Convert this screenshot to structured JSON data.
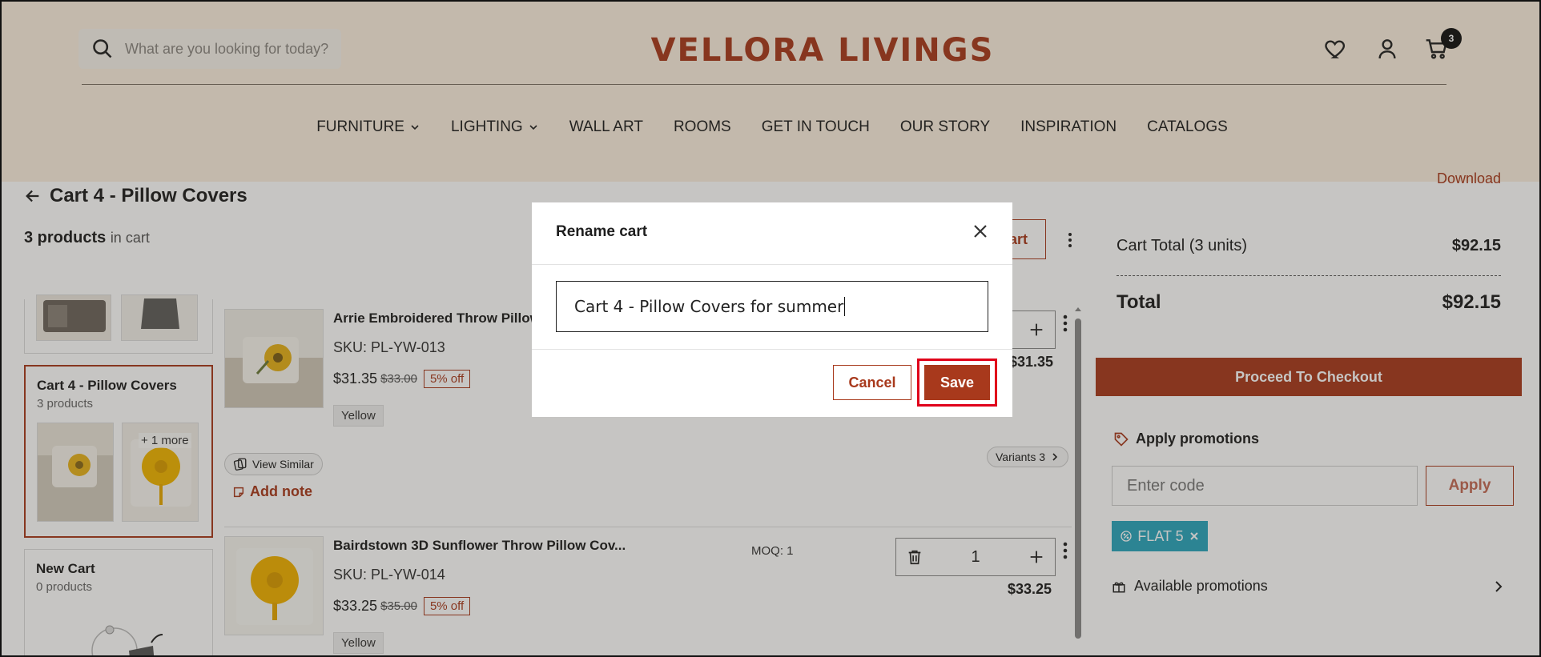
{
  "header": {
    "search_placeholder": "What are you looking for today?",
    "brand": "VELLORA  LIVINGS",
    "cart_count": "3",
    "nav": [
      "FURNITURE",
      "LIGHTING",
      "WALL ART",
      "ROOMS",
      "GET IN TOUCH",
      "OUR STORY",
      "INSPIRATION",
      "CATALOGS"
    ]
  },
  "page": {
    "cart_title": "Cart 4 - Pillow Covers",
    "product_count": "3 products",
    "in_cart": "in cart",
    "download_label": "Download"
  },
  "carts": [
    {
      "name": "Cart 4 - Pillow Covers",
      "count": "3 products",
      "more": "+ 1 more"
    },
    {
      "name": "New Cart",
      "count": "0 products"
    }
  ],
  "products": [
    {
      "name": "Arrie Embroidered Throw Pillow",
      "sku": "SKU: PL-YW-013",
      "price": "$31.35",
      "old_price": "$33.00",
      "discount": "5% off",
      "color": "Yellow",
      "line_total": "$31.35",
      "view_similar": "View Similar",
      "variants": "Variants 3",
      "add_note": "Add note"
    },
    {
      "name": "Bairdstown 3D Sunflower Throw Pillow Cov...",
      "sku": "SKU: PL-YW-014",
      "price": "$33.25",
      "old_price": "$35.00",
      "discount": "5% off",
      "color": "Yellow",
      "moq": "MOQ: 1",
      "qty": "1",
      "line_total": "$33.25"
    }
  ],
  "summary": {
    "total_units_label": "Cart Total (3 units)",
    "total_units_value": "$92.15",
    "total_label": "Total",
    "total_value": "$92.15",
    "checkout": "Proceed To Checkout"
  },
  "promotions": {
    "title": "Apply promotions",
    "placeholder": "Enter code",
    "apply": "Apply",
    "coupon": "FLAT 5",
    "available": "Available promotions"
  },
  "modal": {
    "title": "Rename cart",
    "input_value": "Cart 4 - Pillow Covers for summer",
    "cancel": "Cancel",
    "save": "Save",
    "behind_button_fragment": "art"
  }
}
